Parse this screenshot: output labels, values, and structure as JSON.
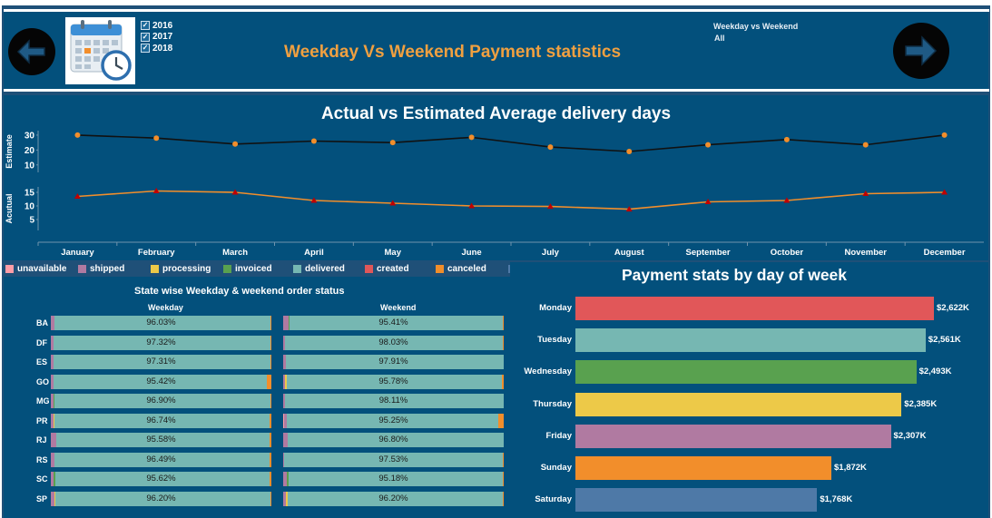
{
  "header": {
    "title": "Weekday Vs Weekend Payment statistics",
    "years": [
      "2016",
      "2017",
      "2018"
    ],
    "filter_title": "Weekday vs Weekend",
    "filter_value": "All",
    "check_glyph": "✓",
    "icons": [
      "arrow-left-icon",
      "calendar-icon",
      "arrow-right-icon"
    ]
  },
  "legend": [
    {
      "label": "unavailable",
      "color": "#ff9da7"
    },
    {
      "label": "shipped",
      "color": "#b07aa1"
    },
    {
      "label": "processing",
      "color": "#edc948"
    },
    {
      "label": "invoiced",
      "color": "#59a14f"
    },
    {
      "label": "delivered",
      "color": "#76b7b2"
    },
    {
      "label": "created",
      "color": "#e15759"
    },
    {
      "label": "canceled",
      "color": "#f28e2b"
    },
    {
      "label": "",
      "color": "#4e79a7"
    }
  ],
  "chart_data": [
    {
      "type": "line",
      "title": "Actual vs Estimated Average delivery days",
      "categories": [
        "January",
        "February",
        "March",
        "April",
        "May",
        "June",
        "July",
        "August",
        "September",
        "October",
        "November",
        "December"
      ],
      "panels": [
        {
          "ylabel": "Estimate",
          "yticks": [
            10,
            20,
            30
          ],
          "ylim": [
            5,
            33
          ],
          "series": [
            {
              "values": [
                30,
                28,
                24,
                26,
                25,
                28.5,
                22,
                19,
                23.5,
                27,
                23.5,
                30
              ]
            }
          ],
          "line_color": "#111111",
          "marker_color": "#f28e2b"
        },
        {
          "ylabel": "Acutual",
          "yticks": [
            5,
            10,
            15
          ],
          "ylim": [
            1,
            17
          ],
          "series": [
            {
              "values": [
                13.5,
                15.5,
                15,
                12,
                11,
                10,
                9.8,
                8.8,
                11.5,
                12,
                14.5,
                15
              ]
            }
          ],
          "line_color": "#f28e2b",
          "marker_color": "#c00000"
        }
      ],
      "grid": false
    },
    {
      "type": "bar",
      "title": "State wise Weekday & weekend order status",
      "columns": [
        "Weekday",
        "Weekend"
      ],
      "states": [
        "BA",
        "DF",
        "ES",
        "GO",
        "MG",
        "PR",
        "RJ",
        "RS",
        "SC",
        "SP"
      ],
      "weekday": [
        {
          "label": "96.03%",
          "segments": [
            {
              "color": "#b07aa1",
              "value": 1.5
            },
            {
              "color": "#e15759",
              "value": 0.3
            },
            {
              "color": "#76b7b2",
              "value": 96.03
            },
            {
              "color": "#f28e2b",
              "value": 0.6
            }
          ]
        },
        {
          "label": "97.32%",
          "segments": [
            {
              "color": "#b07aa1",
              "value": 1.2
            },
            {
              "color": "#76b7b2",
              "value": 97.32
            },
            {
              "color": "#f28e2b",
              "value": 0.4
            }
          ]
        },
        {
          "label": "97.31%",
          "segments": [
            {
              "color": "#b07aa1",
              "value": 1.3
            },
            {
              "color": "#76b7b2",
              "value": 97.31
            },
            {
              "color": "#f28e2b",
              "value": 0.5
            }
          ]
        },
        {
          "label": "95.42%",
          "segments": [
            {
              "color": "#b07aa1",
              "value": 1.3
            },
            {
              "color": "#76b7b2",
              "value": 95.42
            },
            {
              "color": "#f28e2b",
              "value": 2.2
            }
          ]
        },
        {
          "label": "96.90%",
          "segments": [
            {
              "color": "#b07aa1",
              "value": 1.2
            },
            {
              "color": "#59a14f",
              "value": 0.3
            },
            {
              "color": "#76b7b2",
              "value": 96.9
            },
            {
              "color": "#f28e2b",
              "value": 0.5
            }
          ]
        },
        {
          "label": "96.74%",
          "segments": [
            {
              "color": "#b07aa1",
              "value": 1.3
            },
            {
              "color": "#edc948",
              "value": 0.3
            },
            {
              "color": "#76b7b2",
              "value": 96.74
            },
            {
              "color": "#f28e2b",
              "value": 0.7
            }
          ]
        },
        {
          "label": "95.58%",
          "segments": [
            {
              "color": "#b07aa1",
              "value": 2.4
            },
            {
              "color": "#76b7b2",
              "value": 95.58
            },
            {
              "color": "#f28e2b",
              "value": 0.7
            }
          ]
        },
        {
          "label": "96.49%",
          "segments": [
            {
              "color": "#b07aa1",
              "value": 1.5
            },
            {
              "color": "#76b7b2",
              "value": 96.49
            },
            {
              "color": "#f28e2b",
              "value": 0.7
            }
          ]
        },
        {
          "label": "95.62%",
          "segments": [
            {
              "color": "#b07aa1",
              "value": 1.4
            },
            {
              "color": "#59a14f",
              "value": 0.5
            },
            {
              "color": "#76b7b2",
              "value": 95.62
            },
            {
              "color": "#f28e2b",
              "value": 0.7
            }
          ]
        },
        {
          "label": "96.20%",
          "segments": [
            {
              "color": "#b07aa1",
              "value": 1.5
            },
            {
              "color": "#edc948",
              "value": 0.4
            },
            {
              "color": "#76b7b2",
              "value": 96.2
            },
            {
              "color": "#f28e2b",
              "value": 0.6
            }
          ]
        }
      ],
      "weekend": [
        {
          "label": "95.41%",
          "segments": [
            {
              "color": "#b07aa1",
              "value": 2.3
            },
            {
              "color": "#59a14f",
              "value": 0.6
            },
            {
              "color": "#76b7b2",
              "value": 95.41
            },
            {
              "color": "#f28e2b",
              "value": 0.5
            }
          ]
        },
        {
          "label": "98.03%",
          "segments": [
            {
              "color": "#b07aa1",
              "value": 1.0
            },
            {
              "color": "#76b7b2",
              "value": 98.03
            },
            {
              "color": "#f28e2b",
              "value": 0.3
            }
          ]
        },
        {
          "label": "97.91%",
          "segments": [
            {
              "color": "#b07aa1",
              "value": 1.2
            },
            {
              "color": "#76b7b2",
              "value": 97.91
            }
          ]
        },
        {
          "label": "95.78%",
          "segments": [
            {
              "color": "#b07aa1",
              "value": 1.0
            },
            {
              "color": "#edc948",
              "value": 0.6
            },
            {
              "color": "#76b7b2",
              "value": 95.78
            },
            {
              "color": "#f28e2b",
              "value": 0.8
            }
          ]
        },
        {
          "label": "98.11%",
          "segments": [
            {
              "color": "#b07aa1",
              "value": 1.0
            },
            {
              "color": "#76b7b2",
              "value": 98.11
            }
          ]
        },
        {
          "label": "95.25%",
          "segments": [
            {
              "color": "#ff9da7",
              "value": 0.5
            },
            {
              "color": "#b07aa1",
              "value": 1.0
            },
            {
              "color": "#76b7b2",
              "value": 95.25
            },
            {
              "color": "#f28e2b",
              "value": 2.6
            }
          ]
        },
        {
          "label": "96.80%",
          "segments": [
            {
              "color": "#b07aa1",
              "value": 2.2
            },
            {
              "color": "#76b7b2",
              "value": 96.8
            }
          ]
        },
        {
          "label": "97.53%",
          "segments": [
            {
              "color": "#b07aa1",
              "value": 0.6
            },
            {
              "color": "#76b7b2",
              "value": 97.53
            },
            {
              "color": "#f28e2b",
              "value": 0.6
            }
          ]
        },
        {
          "label": "95.18%",
          "segments": [
            {
              "color": "#b07aa1",
              "value": 1.6
            },
            {
              "color": "#59a14f",
              "value": 1.0
            },
            {
              "color": "#76b7b2",
              "value": 95.18
            },
            {
              "color": "#f28e2b",
              "value": 0.6
            }
          ]
        },
        {
          "label": "96.20%",
          "segments": [
            {
              "color": "#b07aa1",
              "value": 1.4
            },
            {
              "color": "#edc948",
              "value": 0.6
            },
            {
              "color": "#76b7b2",
              "value": 96.2
            },
            {
              "color": "#f28e2b",
              "value": 0.6
            }
          ]
        }
      ]
    },
    {
      "type": "bar",
      "orientation": "horizontal",
      "title": "Payment stats by day of week",
      "categories": [
        "Monday",
        "Tuesday",
        "Wednesday",
        "Thursday",
        "Friday",
        "Sunday",
        "Saturday"
      ],
      "values": [
        2622,
        2561,
        2493,
        2385,
        2307,
        1872,
        1768
      ],
      "labels": [
        "$2,622K",
        "$2,561K",
        "$2,493K",
        "$2,385K",
        "$2,307K",
        "$1,872K",
        "$1,768K"
      ],
      "colors": [
        "#e15759",
        "#76b7b2",
        "#59a14f",
        "#edc948",
        "#b07aa1",
        "#f28e2b",
        "#4e79a7"
      ],
      "unit": "K"
    }
  ]
}
